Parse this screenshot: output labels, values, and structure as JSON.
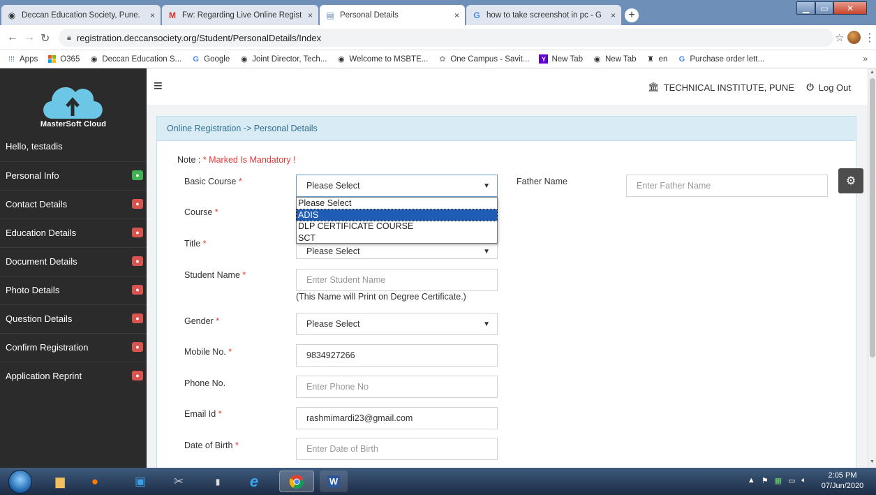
{
  "browser": {
    "tabs": [
      {
        "title": "Deccan Education Society, Pune.",
        "close": "×"
      },
      {
        "title": "Fw: Regarding Live Online Regist",
        "close": "×"
      },
      {
        "title": "Personal Details",
        "close": "×"
      },
      {
        "title": "how to take screenshot in pc - G",
        "close": "×"
      }
    ],
    "new_tab": "+",
    "url": "registration.deccansociety.org/Student/PersonalDetails/Index",
    "bookmarks": [
      "Apps",
      "O365",
      "Deccan Education S...",
      "Google",
      "Joint Director, Tech...",
      "Welcome to MSBTE...",
      "One Campus - Savit...",
      "New Tab",
      "New Tab",
      "en",
      "Purchase order lett..."
    ],
    "bookmarks_more": "»"
  },
  "sidebar": {
    "logo_text": "MasterSoft Cloud",
    "greeting": "Hello, testadis",
    "items": [
      {
        "label": "Personal Info",
        "status": "complete"
      },
      {
        "label": "Contact Details",
        "status": "incomplete"
      },
      {
        "label": "Education Details",
        "status": "incomplete"
      },
      {
        "label": "Document Details",
        "status": "incomplete"
      },
      {
        "label": "Photo Details",
        "status": "incomplete"
      },
      {
        "label": "Question Details",
        "status": "incomplete"
      },
      {
        "label": "Confirm Registration",
        "status": "incomplete"
      },
      {
        "label": "Application Reprint",
        "status": "incomplete"
      }
    ]
  },
  "header": {
    "institute": "TECHNICAL INSTITUTE, PUNE",
    "logout": "Log Out"
  },
  "panel": {
    "breadcrumb": "Online Registration -> Personal Details",
    "note_prefix": "Note : ",
    "note_required": "* Marked Is Mandatory !"
  },
  "form": {
    "basic_course": {
      "label": "Basic Course",
      "required": "*",
      "value": "Please Select"
    },
    "father_name": {
      "label": "Father Name",
      "placeholder": "Enter Father Name"
    },
    "course": {
      "label": "Course",
      "required": "*"
    },
    "title": {
      "label": "Title",
      "required": "*",
      "value": "Please Select"
    },
    "student_name": {
      "label": "Student Name",
      "required": "*",
      "placeholder": "Enter Student Name",
      "hint": "(This Name will Print on Degree Certificate.)"
    },
    "gender": {
      "label": "Gender",
      "required": "*",
      "value": "Please Select"
    },
    "mobile": {
      "label": "Mobile No.",
      "required": "*",
      "value": "9834927266"
    },
    "phone": {
      "label": "Phone No.",
      "placeholder": "Enter Phone No"
    },
    "email": {
      "label": "Email Id",
      "required": "*",
      "value": "rashmimardi23@gmail.com"
    },
    "dob": {
      "label": "Date of Birth",
      "required": "*",
      "placeholder": "Enter Date of Birth"
    }
  },
  "dropdown_options": [
    "Please Select",
    "ADIS",
    "DLP CERTIFICATE COURSE",
    "SCT"
  ],
  "dropdown_highlighted": "ADIS",
  "taskbar": {
    "time": "2:05 PM",
    "date": "07/Jun/2020"
  },
  "colors": {
    "sidebar_bg": "#2b2b2b",
    "panel_header_bg": "#d9ecf6",
    "required_red": "#e53935",
    "badge_green": "#3fb34f",
    "badge_red": "#d9534f",
    "selected_option": "#1e5cb6"
  }
}
